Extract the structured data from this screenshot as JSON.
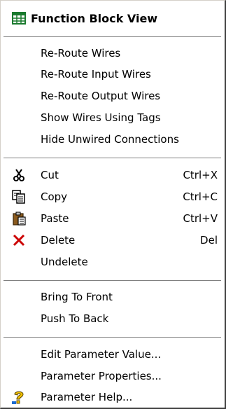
{
  "menu": {
    "header": {
      "label": "Function Block View",
      "icon": "grid-table-icon"
    },
    "wires": [
      {
        "label": "Re-Route Wires"
      },
      {
        "label": "Re-Route Input Wires"
      },
      {
        "label": "Re-Route Output Wires"
      },
      {
        "label": "Show Wires Using Tags"
      },
      {
        "label": "Hide Unwired Connections"
      }
    ],
    "edit": [
      {
        "label": "Cut",
        "shortcut": "Ctrl+X",
        "icon": "scissors-icon"
      },
      {
        "label": "Copy",
        "shortcut": "Ctrl+C",
        "icon": "copy-icon"
      },
      {
        "label": "Paste",
        "shortcut": "Ctrl+V",
        "icon": "paste-icon"
      },
      {
        "label": "Delete",
        "shortcut": "Del",
        "icon": "delete-x-icon"
      },
      {
        "label": "Undelete"
      }
    ],
    "order": [
      {
        "label": "Bring To Front"
      },
      {
        "label": "Push To Back"
      }
    ],
    "parameter": [
      {
        "label": "Edit Parameter Value..."
      },
      {
        "label": "Parameter Properties..."
      },
      {
        "label": "Parameter Help...",
        "icon": "help-icon"
      }
    ],
    "colors": {
      "header_icon": "#1a7a2e",
      "delete_icon": "#cc0000",
      "help_icon": "#f0c000"
    }
  }
}
